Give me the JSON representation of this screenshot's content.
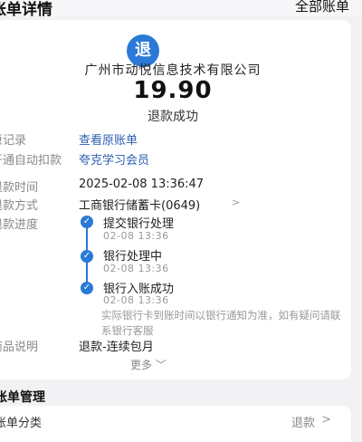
{
  "header": {
    "title": "账单详情",
    "all_bills": "全部账单"
  },
  "summary": {
    "badge_icon": "退",
    "merchant": "广州市动悦信息技术有限公司",
    "amount": "19.90",
    "status": "退款成功"
  },
  "rows": [
    {
      "label": "原记录",
      "value": "查看原账单"
    },
    {
      "label": "开通自动扣款",
      "value": "夸克学习会员"
    },
    {
      "label": "退款时间",
      "value": "2025-02-08 13:36:47"
    },
    {
      "label": "退款方式",
      "value": "工商银行储蓄卡(0649)"
    },
    {
      "label": "退款进度"
    },
    {
      "label": "商品说明",
      "value": "退款-连续包月"
    }
  ],
  "progress": {
    "steps": [
      {
        "title": "提交银行处理",
        "time": "02-08 13:36"
      },
      {
        "title": "银行处理中",
        "time": "02-08 13:36"
      },
      {
        "title": "银行入账成功",
        "time": "02-08 13:36"
      }
    ],
    "note": "实际银行卡到账时间以银行通知为准，如有疑问请联系银行客服"
  },
  "more": "更多",
  "management": {
    "title": "账单管理",
    "category_label": "账单分类",
    "category_value": "退款"
  },
  "colors": {
    "accent": "#2a79d6",
    "link": "#2a5fb0"
  },
  "icons": {
    "badge": "refund-badge-icon",
    "step": "check-icon",
    "chevron": "chevron-right-icon"
  }
}
